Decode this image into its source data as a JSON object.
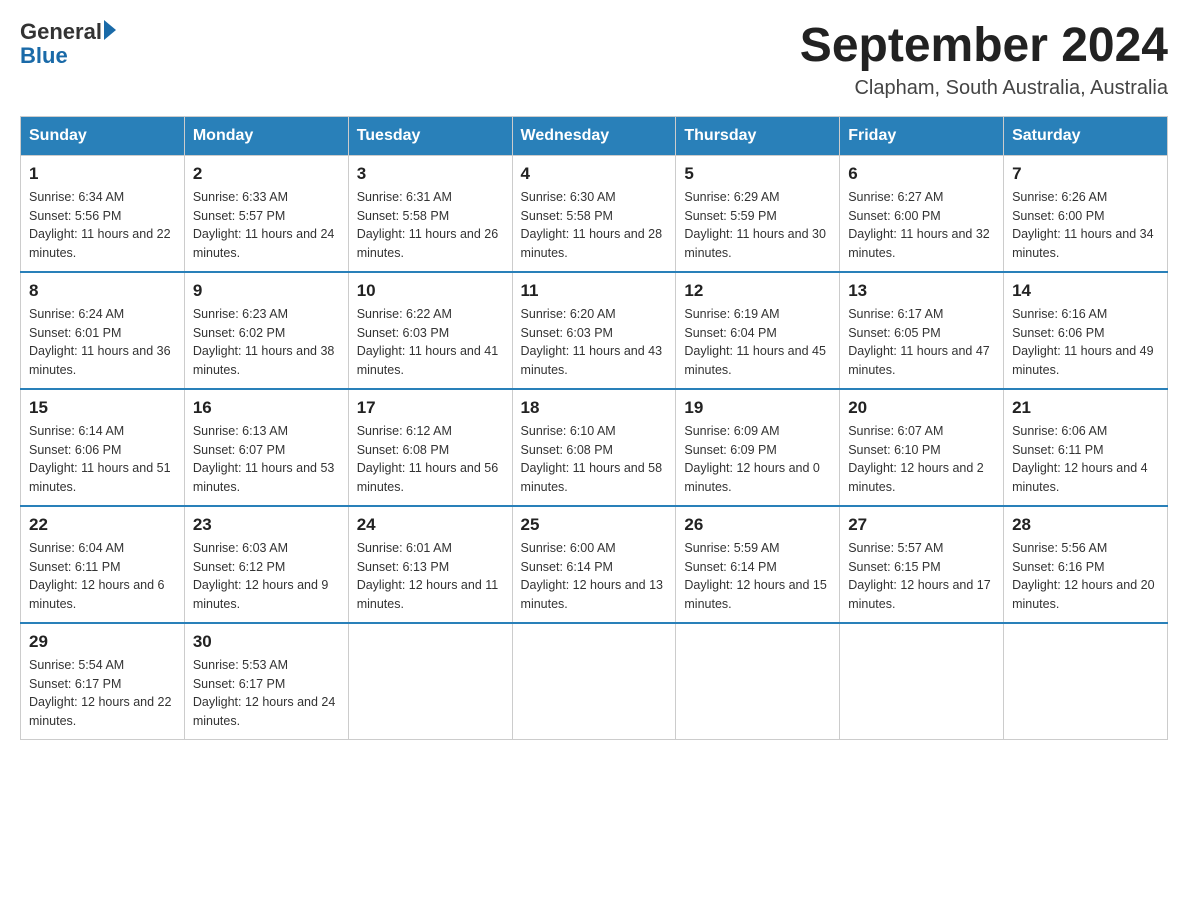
{
  "logo": {
    "general": "General",
    "blue": "Blue"
  },
  "header": {
    "month": "September 2024",
    "location": "Clapham, South Australia, Australia"
  },
  "days_of_week": [
    "Sunday",
    "Monday",
    "Tuesday",
    "Wednesday",
    "Thursday",
    "Friday",
    "Saturday"
  ],
  "weeks": [
    [
      {
        "day": "1",
        "sunrise": "6:34 AM",
        "sunset": "5:56 PM",
        "daylight": "11 hours and 22 minutes."
      },
      {
        "day": "2",
        "sunrise": "6:33 AM",
        "sunset": "5:57 PM",
        "daylight": "11 hours and 24 minutes."
      },
      {
        "day": "3",
        "sunrise": "6:31 AM",
        "sunset": "5:58 PM",
        "daylight": "11 hours and 26 minutes."
      },
      {
        "day": "4",
        "sunrise": "6:30 AM",
        "sunset": "5:58 PM",
        "daylight": "11 hours and 28 minutes."
      },
      {
        "day": "5",
        "sunrise": "6:29 AM",
        "sunset": "5:59 PM",
        "daylight": "11 hours and 30 minutes."
      },
      {
        "day": "6",
        "sunrise": "6:27 AM",
        "sunset": "6:00 PM",
        "daylight": "11 hours and 32 minutes."
      },
      {
        "day": "7",
        "sunrise": "6:26 AM",
        "sunset": "6:00 PM",
        "daylight": "11 hours and 34 minutes."
      }
    ],
    [
      {
        "day": "8",
        "sunrise": "6:24 AM",
        "sunset": "6:01 PM",
        "daylight": "11 hours and 36 minutes."
      },
      {
        "day": "9",
        "sunrise": "6:23 AM",
        "sunset": "6:02 PM",
        "daylight": "11 hours and 38 minutes."
      },
      {
        "day": "10",
        "sunrise": "6:22 AM",
        "sunset": "6:03 PM",
        "daylight": "11 hours and 41 minutes."
      },
      {
        "day": "11",
        "sunrise": "6:20 AM",
        "sunset": "6:03 PM",
        "daylight": "11 hours and 43 minutes."
      },
      {
        "day": "12",
        "sunrise": "6:19 AM",
        "sunset": "6:04 PM",
        "daylight": "11 hours and 45 minutes."
      },
      {
        "day": "13",
        "sunrise": "6:17 AM",
        "sunset": "6:05 PM",
        "daylight": "11 hours and 47 minutes."
      },
      {
        "day": "14",
        "sunrise": "6:16 AM",
        "sunset": "6:06 PM",
        "daylight": "11 hours and 49 minutes."
      }
    ],
    [
      {
        "day": "15",
        "sunrise": "6:14 AM",
        "sunset": "6:06 PM",
        "daylight": "11 hours and 51 minutes."
      },
      {
        "day": "16",
        "sunrise": "6:13 AM",
        "sunset": "6:07 PM",
        "daylight": "11 hours and 53 minutes."
      },
      {
        "day": "17",
        "sunrise": "6:12 AM",
        "sunset": "6:08 PM",
        "daylight": "11 hours and 56 minutes."
      },
      {
        "day": "18",
        "sunrise": "6:10 AM",
        "sunset": "6:08 PM",
        "daylight": "11 hours and 58 minutes."
      },
      {
        "day": "19",
        "sunrise": "6:09 AM",
        "sunset": "6:09 PM",
        "daylight": "12 hours and 0 minutes."
      },
      {
        "day": "20",
        "sunrise": "6:07 AM",
        "sunset": "6:10 PM",
        "daylight": "12 hours and 2 minutes."
      },
      {
        "day": "21",
        "sunrise": "6:06 AM",
        "sunset": "6:11 PM",
        "daylight": "12 hours and 4 minutes."
      }
    ],
    [
      {
        "day": "22",
        "sunrise": "6:04 AM",
        "sunset": "6:11 PM",
        "daylight": "12 hours and 6 minutes."
      },
      {
        "day": "23",
        "sunrise": "6:03 AM",
        "sunset": "6:12 PM",
        "daylight": "12 hours and 9 minutes."
      },
      {
        "day": "24",
        "sunrise": "6:01 AM",
        "sunset": "6:13 PM",
        "daylight": "12 hours and 11 minutes."
      },
      {
        "day": "25",
        "sunrise": "6:00 AM",
        "sunset": "6:14 PM",
        "daylight": "12 hours and 13 minutes."
      },
      {
        "day": "26",
        "sunrise": "5:59 AM",
        "sunset": "6:14 PM",
        "daylight": "12 hours and 15 minutes."
      },
      {
        "day": "27",
        "sunrise": "5:57 AM",
        "sunset": "6:15 PM",
        "daylight": "12 hours and 17 minutes."
      },
      {
        "day": "28",
        "sunrise": "5:56 AM",
        "sunset": "6:16 PM",
        "daylight": "12 hours and 20 minutes."
      }
    ],
    [
      {
        "day": "29",
        "sunrise": "5:54 AM",
        "sunset": "6:17 PM",
        "daylight": "12 hours and 22 minutes."
      },
      {
        "day": "30",
        "sunrise": "5:53 AM",
        "sunset": "6:17 PM",
        "daylight": "12 hours and 24 minutes."
      },
      null,
      null,
      null,
      null,
      null
    ]
  ]
}
